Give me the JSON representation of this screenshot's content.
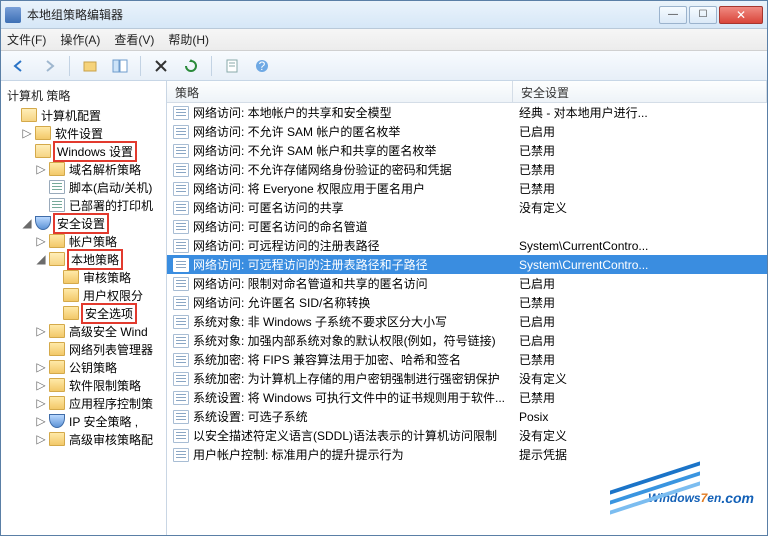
{
  "window": {
    "title": "本地组策略编辑器"
  },
  "menu": {
    "file": "文件(F)",
    "action": "操作(A)",
    "view": "查看(V)",
    "help": "帮助(H)"
  },
  "toolbar_icons": [
    "back",
    "forward",
    "up",
    "show-tree",
    "delete",
    "refresh",
    "properties",
    "help"
  ],
  "tree": {
    "root": "计算机 策略",
    "nodes": [
      {
        "indent": 0,
        "twist": "",
        "icon": "folder-open",
        "label": "计算机配置"
      },
      {
        "indent": 1,
        "twist": "▷",
        "icon": "folder",
        "label": "软件设置"
      },
      {
        "indent": 1,
        "twist": "",
        "icon": "folder-open",
        "label": "Windows 设置",
        "red": true
      },
      {
        "indent": 2,
        "twist": "▷",
        "icon": "folder",
        "label": "域名解析策略"
      },
      {
        "indent": 2,
        "twist": "",
        "icon": "doc",
        "label": "脚本(启动/关机)"
      },
      {
        "indent": 2,
        "twist": "",
        "icon": "doc",
        "label": "已部署的打印机"
      },
      {
        "indent": 1,
        "twist": "◢",
        "icon": "shield",
        "label": "安全设置",
        "red": true
      },
      {
        "indent": 2,
        "twist": "▷",
        "icon": "folder",
        "label": "帐户策略"
      },
      {
        "indent": 2,
        "twist": "◢",
        "icon": "folder-open",
        "label": "本地策略",
        "red": true
      },
      {
        "indent": 3,
        "twist": "",
        "icon": "folder",
        "label": "审核策略"
      },
      {
        "indent": 3,
        "twist": "",
        "icon": "folder",
        "label": "用户权限分"
      },
      {
        "indent": 3,
        "twist": "",
        "icon": "folder",
        "label": "安全选项",
        "red": true
      },
      {
        "indent": 2,
        "twist": "▷",
        "icon": "folder",
        "label": "高级安全 Wind"
      },
      {
        "indent": 2,
        "twist": "",
        "icon": "folder",
        "label": "网络列表管理器"
      },
      {
        "indent": 2,
        "twist": "▷",
        "icon": "folder",
        "label": "公钥策略"
      },
      {
        "indent": 2,
        "twist": "▷",
        "icon": "folder",
        "label": "软件限制策略"
      },
      {
        "indent": 2,
        "twist": "▷",
        "icon": "folder",
        "label": "应用程序控制策"
      },
      {
        "indent": 2,
        "twist": "▷",
        "icon": "shield",
        "label": "IP 安全策略 ,"
      },
      {
        "indent": 2,
        "twist": "▷",
        "icon": "folder",
        "label": "高级审核策略配"
      }
    ]
  },
  "list": {
    "col_policy": "策略",
    "col_security": "安全设置",
    "rows": [
      {
        "p": "网络访问: 本地帐户的共享和安全模型",
        "s": "经典 - 对本地用户进行..."
      },
      {
        "p": "网络访问: 不允许 SAM 帐户的匿名枚举",
        "s": "已启用"
      },
      {
        "p": "网络访问: 不允许 SAM 帐户和共享的匿名枚举",
        "s": "已禁用"
      },
      {
        "p": "网络访问: 不允许存储网络身份验证的密码和凭据",
        "s": "已禁用"
      },
      {
        "p": "网络访问: 将 Everyone 权限应用于匿名用户",
        "s": "已禁用"
      },
      {
        "p": "网络访问: 可匿名访问的共享",
        "s": "没有定义"
      },
      {
        "p": "网络访问: 可匿名访问的命名管道",
        "s": ""
      },
      {
        "p": "网络访问: 可远程访问的注册表路径",
        "s": "System\\CurrentContro..."
      },
      {
        "p": "网络访问: 可远程访问的注册表路径和子路径",
        "s": "System\\CurrentContro...",
        "selected": true
      },
      {
        "p": "网络访问: 限制对命名管道和共享的匿名访问",
        "s": "已启用"
      },
      {
        "p": "网络访问: 允许匿名 SID/名称转换",
        "s": "已禁用"
      },
      {
        "p": "系统对象: 非 Windows 子系统不要求区分大小写",
        "s": "已启用"
      },
      {
        "p": "系统对象: 加强内部系统对象的默认权限(例如，符号链接)",
        "s": "已启用"
      },
      {
        "p": "系统加密: 将 FIPS 兼容算法用于加密、哈希和签名",
        "s": "已禁用"
      },
      {
        "p": "系统加密: 为计算机上存储的用户密钥强制进行强密钥保护",
        "s": "没有定义"
      },
      {
        "p": "系统设置: 将 Windows 可执行文件中的证书规则用于软件...",
        "s": "已禁用"
      },
      {
        "p": "系统设置: 可选子系统",
        "s": "Posix"
      },
      {
        "p": "以安全描述符定义语言(SDDL)语法表示的计算机访问限制",
        "s": "没有定义"
      },
      {
        "p": "用户帐户控制: 标准用户的提升提示行为",
        "s": "提示凭据"
      }
    ]
  },
  "watermark": {
    "brand_a": "Windows",
    "brand_b": "7",
    "suffix_a": "en",
    "suffix_b": ".com"
  }
}
